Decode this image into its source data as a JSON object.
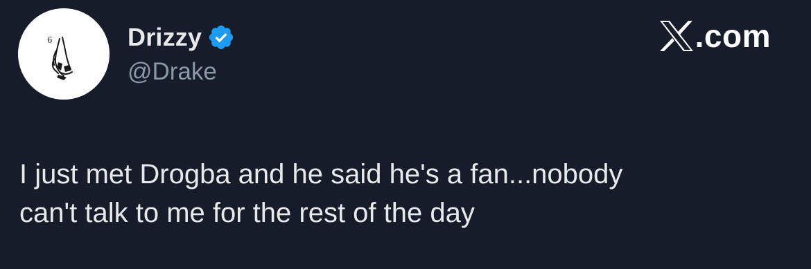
{
  "author": {
    "display_name": "Drizzy",
    "handle": "@Drake",
    "verified": true,
    "avatar_icon": "praying-hands-6-logo-icon",
    "avatar_logo_text": "6",
    "verified_icon": "verified-badge-icon",
    "verified_color": "#1d9bf0"
  },
  "brand": {
    "icon": "x-logo-icon",
    "suffix": ".com"
  },
  "tweet": {
    "lines": [
      "I just met Drogba and he said he's a fan...nobody",
      "can't talk to me for the rest of the day"
    ]
  },
  "colors": {
    "background": "#161c29",
    "text_primary": "#e7e9ea",
    "text_secondary": "#8b98a5"
  }
}
